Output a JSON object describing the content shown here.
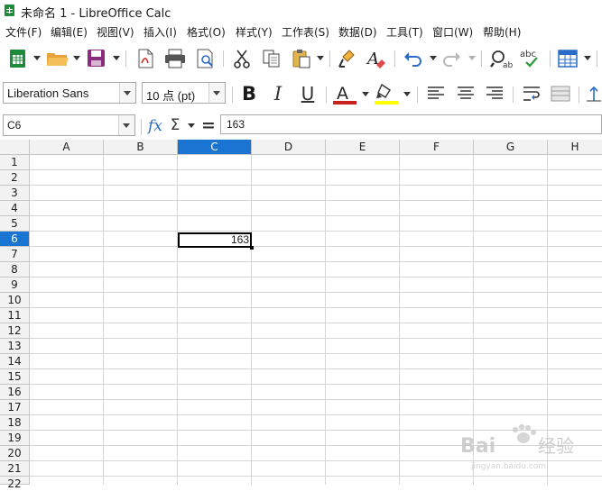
{
  "window": {
    "title": "未命名 1 - LibreOffice Calc"
  },
  "menubar": {
    "items": [
      "文件(F)",
      "编辑(E)",
      "视图(V)",
      "插入(I)",
      "格式(O)",
      "样式(Y)",
      "工作表(S)",
      "数据(D)",
      "工具(T)",
      "窗口(W)",
      "帮助(H)"
    ]
  },
  "toolbar": {
    "icons": [
      "new-spreadsheet-icon",
      "open-folder-icon",
      "save-icon",
      "export-pdf-icon",
      "print-icon",
      "print-preview-icon",
      "cut-icon",
      "copy-icon",
      "paste-icon",
      "clone-formatting-icon",
      "clear-formatting-icon",
      "undo-icon",
      "redo-icon",
      "find-replace-icon",
      "spellcheck-icon",
      "table-borders-icon"
    ],
    "spellcheck_label": "abc"
  },
  "format_toolbar": {
    "font_name": "Liberation Sans",
    "font_size": "10 点 (pt)",
    "bold_label": "B",
    "italic_label": "I",
    "underline_label": "U",
    "font_color_label": "A",
    "font_color": "#c9211e",
    "highlight_color": "#ffff00"
  },
  "formula_bar": {
    "name_box": "C6",
    "fx_label": "fx",
    "sum_label": "Σ",
    "equals_label": "=",
    "content": "163"
  },
  "sheet": {
    "columns": [
      "A",
      "B",
      "C",
      "D",
      "E",
      "F",
      "G",
      "H"
    ],
    "rows": [
      "1",
      "2",
      "3",
      "4",
      "5",
      "6",
      "7",
      "8",
      "9",
      "10",
      "11",
      "12",
      "13",
      "14",
      "15",
      "16",
      "17",
      "18",
      "19",
      "20",
      "21",
      "22"
    ],
    "active_column": "C",
    "active_row": "6",
    "active_cell_value": "163",
    "selection_color": "#1a75d2"
  },
  "watermark": {
    "text": "Bai经验",
    "sub": "jingyan.baidu.com"
  }
}
